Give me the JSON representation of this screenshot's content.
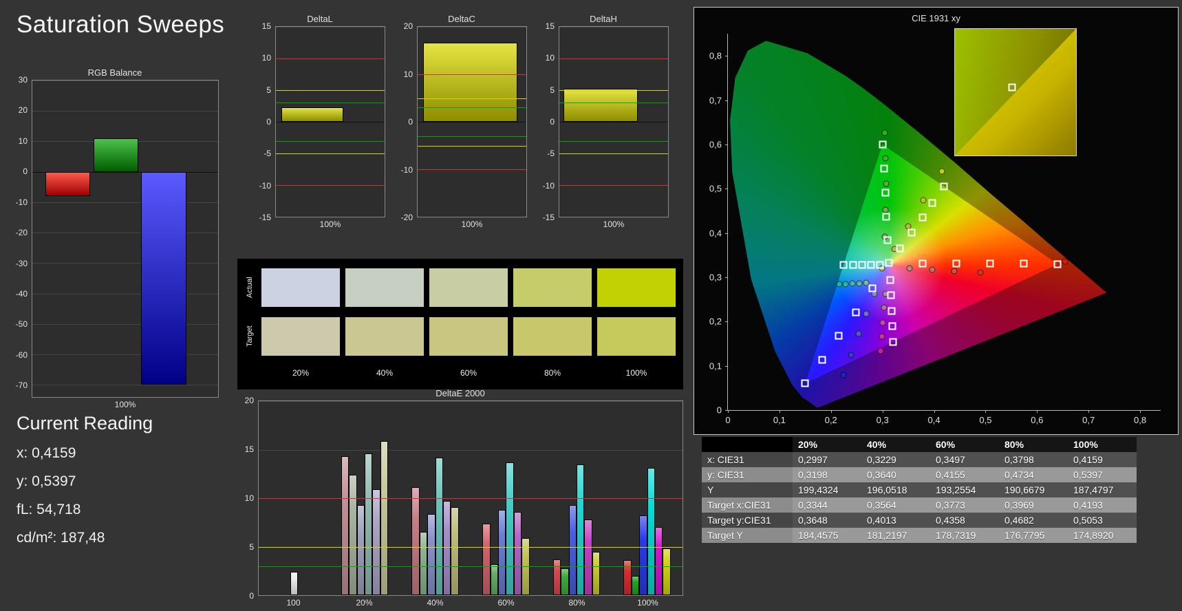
{
  "page_title": "Saturation Sweeps",
  "current_reading": {
    "title": "Current Reading",
    "lines": [
      "x: 0,4159",
      "y: 0,5397",
      "fL: 54,718",
      "cd/m²: 187,48"
    ]
  },
  "rgb_balance": {
    "type": "bar",
    "title": "RGB Balance",
    "xlabel": "100%",
    "ylim": [
      -74,
      30
    ],
    "yticks": [
      30,
      20,
      10,
      0,
      -10,
      -20,
      -30,
      -40,
      -50,
      -60,
      -70
    ],
    "bars": [
      {
        "name": "red",
        "value": -8,
        "grad": [
          "#ff5a4a",
          "#9c0000"
        ]
      },
      {
        "name": "green",
        "value": 11,
        "grad": [
          "#4cc24c",
          "#005c00"
        ]
      },
      {
        "name": "blue",
        "value": -70,
        "grad": [
          "#5a5aff",
          "#000086"
        ]
      }
    ]
  },
  "delta_bar_grad": [
    "#e4e442",
    "#8d8d00"
  ],
  "delta_charts": [
    {
      "id": "deltaL-chart",
      "title": "DeltaL",
      "xlabel": "100%",
      "ylim": [
        -15,
        15
      ],
      "yticks": [
        15,
        10,
        5,
        0,
        -5,
        -10,
        -15
      ],
      "value": 2.3,
      "bar_span": [
        0.05,
        0.62
      ],
      "ref_lines": [
        {
          "v": 10,
          "color": "#d83030"
        },
        {
          "v": 5,
          "color": "#d8d800"
        },
        {
          "v": 3,
          "color": "#00a800"
        },
        {
          "v": -3,
          "color": "#00a800"
        },
        {
          "v": -5,
          "color": "#d8d800"
        },
        {
          "v": -10,
          "color": "#d83030"
        }
      ]
    },
    {
      "id": "deltaC-chart",
      "title": "DeltaC",
      "xlabel": "100%",
      "ylim": [
        -20,
        20
      ],
      "yticks": [
        20,
        10,
        0,
        -10,
        -20
      ],
      "value": 16.6,
      "bar_span": [
        0.05,
        0.92
      ],
      "ref_lines": [
        {
          "v": 10,
          "color": "#d83030"
        },
        {
          "v": 5,
          "color": "#d8d800"
        },
        {
          "v": 3,
          "color": "#00a800"
        },
        {
          "v": -3,
          "color": "#00a800"
        },
        {
          "v": -5,
          "color": "#d8d800"
        },
        {
          "v": -10,
          "color": "#d83030"
        }
      ]
    },
    {
      "id": "deltaH-chart",
      "title": "DeltaH",
      "xlabel": "100%",
      "ylim": [
        -15,
        15
      ],
      "yticks": [
        15,
        10,
        5,
        0,
        -5,
        -10,
        -15
      ],
      "value": 5.2,
      "bar_span": [
        0.04,
        0.72
      ],
      "ref_lines": [
        {
          "v": 10,
          "color": "#d83030"
        },
        {
          "v": 5,
          "color": "#d8d800"
        },
        {
          "v": 3,
          "color": "#00a800"
        },
        {
          "v": -3,
          "color": "#00a800"
        },
        {
          "v": -5,
          "color": "#d8d800"
        },
        {
          "v": -10,
          "color": "#d83030"
        }
      ]
    }
  ],
  "swatches": {
    "row_labels": [
      "Actual",
      "Target"
    ],
    "col_labels": [
      "20%",
      "40%",
      "60%",
      "80%",
      "100%"
    ],
    "actual": [
      "#ccd2e2",
      "#c6cfc2",
      "#c8cda4",
      "#c5cd6a",
      "#c2d104"
    ],
    "target": [
      "#cdc9ad",
      "#cbc793",
      "#c9c681",
      "#c9c76c",
      "#c6c95c"
    ]
  },
  "deltae": {
    "type": "bar",
    "title": "DeltaE 2000",
    "ylim": [
      0,
      20
    ],
    "yticks": [
      0,
      5,
      10,
      15,
      20
    ],
    "bar_width_pct": 1.85,
    "ref_lines": [
      {
        "v": 10,
        "color": "#d83030"
      },
      {
        "v": 5,
        "color": "#d8d800"
      },
      {
        "v": 3,
        "color": "#00a800"
      }
    ],
    "groups": [
      {
        "label": "100",
        "bars": [
          {
            "c": "#ececec",
            "v": 2.4
          }
        ]
      },
      {
        "label": "20%",
        "bars": [
          {
            "c": "#c49097",
            "v": 14.3
          },
          {
            "c": "#a9b29f",
            "v": 12.4
          },
          {
            "c": "#9fa3bd",
            "v": 9.3
          },
          {
            "c": "#93bcb4",
            "v": 14.6
          },
          {
            "c": "#ada4c6",
            "v": 10.9
          },
          {
            "c": "#c9c99e",
            "v": 15.9
          }
        ]
      },
      {
        "label": "40%",
        "bars": [
          {
            "c": "#c97c85",
            "v": 11.1
          },
          {
            "c": "#8cb48b",
            "v": 6.5
          },
          {
            "c": "#8a92cb",
            "v": 8.4
          },
          {
            "c": "#6cc4be",
            "v": 14.2
          },
          {
            "c": "#a98cd0",
            "v": 9.7
          },
          {
            "c": "#bdbd7b",
            "v": 9.1
          }
        ]
      },
      {
        "label": "60%",
        "bars": [
          {
            "c": "#d1636b",
            "v": 7.4
          },
          {
            "c": "#63ad60",
            "v": 3.2
          },
          {
            "c": "#6b7cd6",
            "v": 8.8
          },
          {
            "c": "#45cdc8",
            "v": 13.7
          },
          {
            "c": "#b564c9",
            "v": 8.6
          },
          {
            "c": "#c3c356",
            "v": 5.9
          }
        ]
      },
      {
        "label": "80%",
        "bars": [
          {
            "c": "#d9474f",
            "v": 3.7
          },
          {
            "c": "#3dab3b",
            "v": 2.8
          },
          {
            "c": "#4a5ee0",
            "v": 9.3
          },
          {
            "c": "#23d6d2",
            "v": 13.5
          },
          {
            "c": "#c341c5",
            "v": 7.8
          },
          {
            "c": "#caca31",
            "v": 4.5
          }
        ]
      },
      {
        "label": "100%",
        "bars": [
          {
            "c": "#e02a2a",
            "v": 3.6
          },
          {
            "c": "#1ca81a",
            "v": 2.0
          },
          {
            "c": "#2a3aea",
            "v": 8.2
          },
          {
            "c": "#06dcd8",
            "v": 13.1
          },
          {
            "c": "#d512d0",
            "v": 7.0
          },
          {
            "c": "#d2d212",
            "v": 4.8
          }
        ]
      }
    ]
  },
  "cie": {
    "title": "CIE 1931 xy",
    "xmax": 0.84,
    "ymax": 0.85,
    "tick_step": 0.1,
    "xtick_labels": [
      "0",
      "0,1",
      "0,2",
      "0,3",
      "0,4",
      "0,5",
      "0,6",
      "0,7",
      "0,8"
    ],
    "ytick_labels": [
      "0",
      "0,1",
      "0,2",
      "0,3",
      "0,4",
      "0,5",
      "0,6",
      "0,7",
      "0,8"
    ],
    "inset_marker": {
      "left_pct": 47,
      "top_pct": 46
    },
    "targets": [
      [
        0.313,
        0.332
      ],
      [
        0.3784,
        0.3316
      ],
      [
        0.4438,
        0.3312
      ],
      [
        0.5092,
        0.3308
      ],
      [
        0.5746,
        0.3304
      ],
      [
        0.64,
        0.33
      ],
      [
        0.3104,
        0.3832
      ],
      [
        0.3078,
        0.4374
      ],
      [
        0.3052,
        0.4916
      ],
      [
        0.3026,
        0.5458
      ],
      [
        0.3,
        0.6
      ],
      [
        0.2804,
        0.2752
      ],
      [
        0.2478,
        0.2214
      ],
      [
        0.2152,
        0.1676
      ],
      [
        0.1826,
        0.1138
      ],
      [
        0.15,
        0.06
      ],
      [
        0.2954,
        0.3284
      ],
      [
        0.2778,
        0.3282
      ],
      [
        0.2602,
        0.328
      ],
      [
        0.2426,
        0.3278
      ],
      [
        0.225,
        0.3276
      ],
      [
        0.3146,
        0.294
      ],
      [
        0.3162,
        0.259
      ],
      [
        0.3178,
        0.224
      ],
      [
        0.3194,
        0.189
      ],
      [
        0.321,
        0.154
      ],
      [
        0.3344,
        0.3648
      ],
      [
        0.3564,
        0.4013
      ],
      [
        0.3773,
        0.4358
      ],
      [
        0.3969,
        0.4682
      ],
      [
        0.4193,
        0.5053
      ]
    ],
    "measurements": [
      {
        "x": 0.2997,
        "y": 0.3198,
        "c": "#b8b46a"
      },
      {
        "x": 0.3229,
        "y": 0.364,
        "c": "#b9b455"
      },
      {
        "x": 0.3497,
        "y": 0.4155,
        "c": "#bcb83e"
      },
      {
        "x": 0.3798,
        "y": 0.4734,
        "c": "#bec025"
      },
      {
        "x": 0.4159,
        "y": 0.5397,
        "c": "#c3cc0a"
      },
      {
        "x": 0.305,
        "y": 0.392,
        "c": "#8fae64"
      },
      {
        "x": 0.306,
        "y": 0.452,
        "c": "#76ad4e"
      },
      {
        "x": 0.307,
        "y": 0.512,
        "c": "#5cae39"
      },
      {
        "x": 0.306,
        "y": 0.568,
        "c": "#43b027"
      },
      {
        "x": 0.304,
        "y": 0.627,
        "c": "#2bb411"
      },
      {
        "x": 0.268,
        "y": 0.287,
        "c": "#7fb2a6"
      },
      {
        "x": 0.255,
        "y": 0.286,
        "c": "#63b3a6"
      },
      {
        "x": 0.242,
        "y": 0.286,
        "c": "#47b5a7"
      },
      {
        "x": 0.229,
        "y": 0.285,
        "c": "#2cb6a8"
      },
      {
        "x": 0.216,
        "y": 0.285,
        "c": "#12b8a9"
      },
      {
        "x": 0.284,
        "y": 0.263,
        "c": "#8a8fc0"
      },
      {
        "x": 0.269,
        "y": 0.218,
        "c": "#6e74c4"
      },
      {
        "x": 0.254,
        "y": 0.172,
        "c": "#5358c9"
      },
      {
        "x": 0.239,
        "y": 0.125,
        "c": "#383dce"
      },
      {
        "x": 0.225,
        "y": 0.08,
        "c": "#1e22d3"
      },
      {
        "x": 0.306,
        "y": 0.263,
        "c": "#b584ad"
      },
      {
        "x": 0.303,
        "y": 0.231,
        "c": "#bb6aa9"
      },
      {
        "x": 0.301,
        "y": 0.198,
        "c": "#c14fa5"
      },
      {
        "x": 0.299,
        "y": 0.166,
        "c": "#c835a1"
      },
      {
        "x": 0.297,
        "y": 0.134,
        "c": "#ce1a9d"
      },
      {
        "x": 0.352,
        "y": 0.32,
        "c": "#c08a7e"
      },
      {
        "x": 0.396,
        "y": 0.317,
        "c": "#c66f60"
      },
      {
        "x": 0.44,
        "y": 0.314,
        "c": "#cc5442"
      },
      {
        "x": 0.49,
        "y": 0.311,
        "c": "#d23924"
      },
      {
        "x": 0.655,
        "y": 0.335,
        "c": "#d81e06"
      }
    ]
  },
  "table": {
    "col_headers": [
      "20%",
      "40%",
      "60%",
      "80%",
      "100%"
    ],
    "rows": [
      {
        "label": "x: CIE31",
        "values": [
          "0,2997",
          "0,3229",
          "0,3497",
          "0,3798",
          "0,4159"
        ]
      },
      {
        "label": "y: CIE31",
        "values": [
          "0,3198",
          "0,3640",
          "0,4155",
          "0,4734",
          "0,5397"
        ]
      },
      {
        "label": "Y",
        "values": [
          "199,4324",
          "196,0518",
          "193,2554",
          "190,6679",
          "187,4797"
        ]
      },
      {
        "label": "Target x:CIE31",
        "values": [
          "0,3344",
          "0,3564",
          "0,3773",
          "0,3969",
          "0,4193"
        ]
      },
      {
        "label": "Target y:CIE31",
        "values": [
          "0,3648",
          "0,4013",
          "0,4358",
          "0,4682",
          "0,5053"
        ]
      },
      {
        "label": "Target Y",
        "values": [
          "184,4575",
          "181,2197",
          "178,7319",
          "176,7795",
          "174,8920"
        ]
      }
    ]
  }
}
